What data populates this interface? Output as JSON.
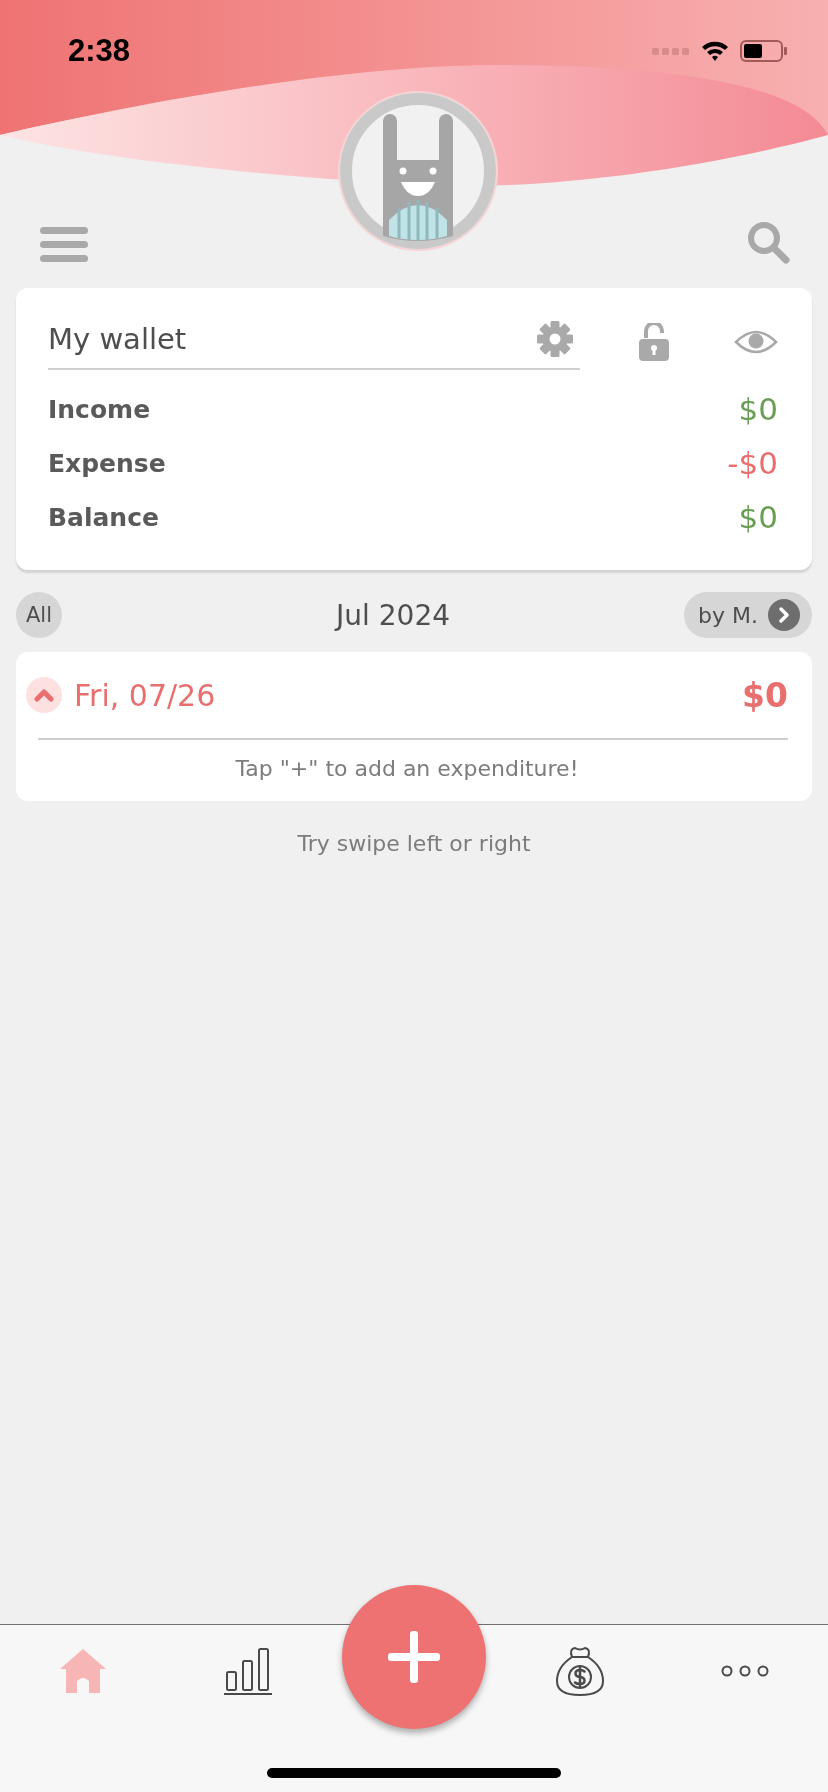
{
  "status_bar": {
    "time": "2:38"
  },
  "wallet": {
    "title": "My wallet",
    "locked": false,
    "summary": [
      {
        "label": "Income",
        "amount": "$0",
        "kind": "income"
      },
      {
        "label": "Expense",
        "amount": "-$0",
        "kind": "expense"
      },
      {
        "label": "Balance",
        "amount": "$0",
        "kind": "balance"
      }
    ]
  },
  "period": {
    "all_label": "All",
    "title": "Jul 2024",
    "group_label": "by M."
  },
  "days": [
    {
      "date": "Fri, 07/26",
      "total": "$0",
      "expanded": true,
      "message": "Tap \"+\" to add an expenditure!"
    }
  ],
  "hint": "Try swipe left or right",
  "tab_bar": {
    "tabs": [
      {
        "kind": "home",
        "selected": true
      },
      {
        "kind": "stats",
        "selected": false
      },
      {
        "kind": "add",
        "selected": false
      },
      {
        "kind": "budget",
        "selected": false
      },
      {
        "kind": "more",
        "selected": false
      }
    ]
  }
}
